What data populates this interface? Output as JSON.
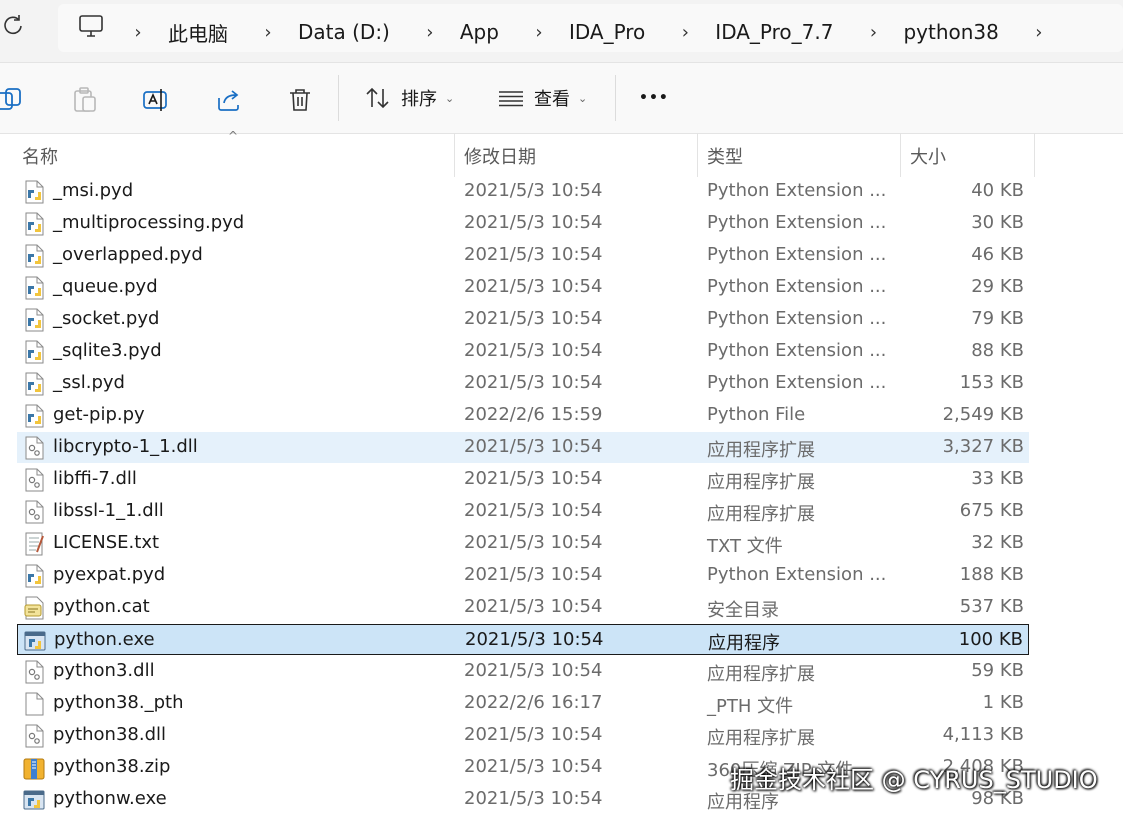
{
  "address": {
    "crumbs": [
      "此电脑",
      "Data (D:)",
      "App",
      "IDA_Pro",
      "IDA_Pro_7.7",
      "python38"
    ]
  },
  "toolbar": {
    "sort_label": "排序",
    "view_label": "查看",
    "more_label": "•••"
  },
  "columns": {
    "name": "名称",
    "modified": "修改日期",
    "type": "类型",
    "size": "大小"
  },
  "files": [
    {
      "name": "_msi.pyd",
      "modified": "2021/5/3 10:54",
      "type": "Python Extension ...",
      "size": "40 KB",
      "icon": "python-file-icon"
    },
    {
      "name": "_multiprocessing.pyd",
      "modified": "2021/5/3 10:54",
      "type": "Python Extension ...",
      "size": "30 KB",
      "icon": "python-file-icon"
    },
    {
      "name": "_overlapped.pyd",
      "modified": "2021/5/3 10:54",
      "type": "Python Extension ...",
      "size": "46 KB",
      "icon": "python-file-icon"
    },
    {
      "name": "_queue.pyd",
      "modified": "2021/5/3 10:54",
      "type": "Python Extension ...",
      "size": "29 KB",
      "icon": "python-file-icon"
    },
    {
      "name": "_socket.pyd",
      "modified": "2021/5/3 10:54",
      "type": "Python Extension ...",
      "size": "79 KB",
      "icon": "python-file-icon"
    },
    {
      "name": "_sqlite3.pyd",
      "modified": "2021/5/3 10:54",
      "type": "Python Extension ...",
      "size": "88 KB",
      "icon": "python-file-icon"
    },
    {
      "name": "_ssl.pyd",
      "modified": "2021/5/3 10:54",
      "type": "Python Extension ...",
      "size": "153 KB",
      "icon": "python-file-icon"
    },
    {
      "name": "get-pip.py",
      "modified": "2022/2/6 15:59",
      "type": "Python File",
      "size": "2,549 KB",
      "icon": "python-file-icon"
    },
    {
      "name": "libcrypto-1_1.dll",
      "modified": "2021/5/3 10:54",
      "type": "应用程序扩展",
      "size": "3,327 KB",
      "icon": "dll-file-icon"
    },
    {
      "name": "libffi-7.dll",
      "modified": "2021/5/3 10:54",
      "type": "应用程序扩展",
      "size": "33 KB",
      "icon": "dll-file-icon"
    },
    {
      "name": "libssl-1_1.dll",
      "modified": "2021/5/3 10:54",
      "type": "应用程序扩展",
      "size": "675 KB",
      "icon": "dll-file-icon"
    },
    {
      "name": "LICENSE.txt",
      "modified": "2021/5/3 10:54",
      "type": "TXT 文件",
      "size": "32 KB",
      "icon": "text-file-icon"
    },
    {
      "name": "pyexpat.pyd",
      "modified": "2021/5/3 10:54",
      "type": "Python Extension ...",
      "size": "188 KB",
      "icon": "python-file-icon"
    },
    {
      "name": "python.cat",
      "modified": "2021/5/3 10:54",
      "type": "安全目录",
      "size": "537 KB",
      "icon": "catalog-file-icon"
    },
    {
      "name": "python.exe",
      "modified": "2021/5/3 10:54",
      "type": "应用程序",
      "size": "100 KB",
      "icon": "python-exe-icon"
    },
    {
      "name": "python3.dll",
      "modified": "2021/5/3 10:54",
      "type": "应用程序扩展",
      "size": "59 KB",
      "icon": "dll-file-icon"
    },
    {
      "name": "python38._pth",
      "modified": "2022/2/6 16:17",
      "type": "_PTH 文件",
      "size": "1 KB",
      "icon": "blank-file-icon"
    },
    {
      "name": "python38.dll",
      "modified": "2021/5/3 10:54",
      "type": "应用程序扩展",
      "size": "4,113 KB",
      "icon": "dll-file-icon"
    },
    {
      "name": "python38.zip",
      "modified": "2021/5/3 10:54",
      "type": "360压缩 ZIP 文件",
      "size": "2,408 KB",
      "icon": "zip-file-icon"
    },
    {
      "name": "pythonw.exe",
      "modified": "2021/5/3 10:54",
      "type": "应用程序",
      "size": "98 KB",
      "icon": "python-exe-icon"
    }
  ],
  "hover_row": 8,
  "selected_row": 14,
  "watermark": "掘金技术社区 @ CYRUS_STUDIO"
}
